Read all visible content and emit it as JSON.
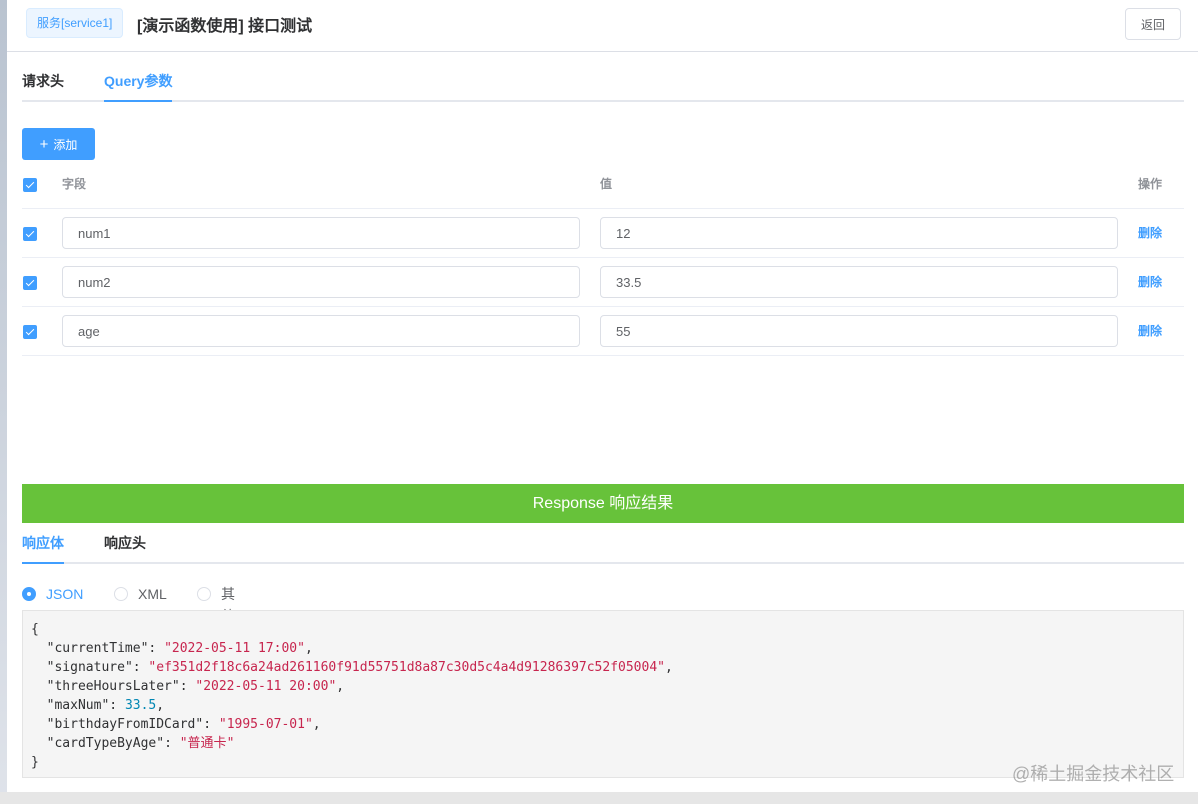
{
  "header": {
    "service_tag": "服务[service1]",
    "title": "[演示函数使用] 接口测试",
    "back_label": "返回"
  },
  "request_tabs": [
    {
      "label": "请求头",
      "active": false
    },
    {
      "label": "Query参数",
      "active": true
    }
  ],
  "add_button_label": "添加",
  "table": {
    "headers": {
      "field": "字段",
      "value": "值",
      "actions": "操作"
    },
    "rows": [
      {
        "checked": true,
        "field": "num1",
        "value": "12",
        "action": "删除"
      },
      {
        "checked": true,
        "field": "num2",
        "value": "33.5",
        "action": "删除"
      },
      {
        "checked": true,
        "field": "age",
        "value": "55",
        "action": "删除"
      }
    ]
  },
  "response": {
    "banner": "Response 响应结果",
    "tabs": [
      {
        "label": "响应体",
        "active": true
      },
      {
        "label": "响应头",
        "active": false
      }
    ],
    "formats": [
      {
        "label": "JSON",
        "checked": true
      },
      {
        "label": "XML",
        "checked": false
      },
      {
        "label": "其他类型",
        "checked": false
      }
    ],
    "body": [
      {
        "key": "currentTime",
        "value": "2022-05-11 17:00",
        "type": "string"
      },
      {
        "key": "signature",
        "value": "ef351d2f18c6a24ad261160f91d55751d8a87c30d5c4a4d91286397c52f05004",
        "type": "string"
      },
      {
        "key": "threeHoursLater",
        "value": "2022-05-11 20:00",
        "type": "string"
      },
      {
        "key": "maxNum",
        "value": "33.5",
        "type": "number"
      },
      {
        "key": "birthdayFromIDCard",
        "value": "1995-07-01",
        "type": "string"
      },
      {
        "key": "cardTypeByAge",
        "value": "普通卡",
        "type": "string"
      }
    ]
  },
  "watermark": "@稀土掘金技术社区",
  "colors": {
    "primary": "#409eff",
    "success": "#67c23a",
    "string": "#c7254e",
    "number": "#0086b3"
  }
}
